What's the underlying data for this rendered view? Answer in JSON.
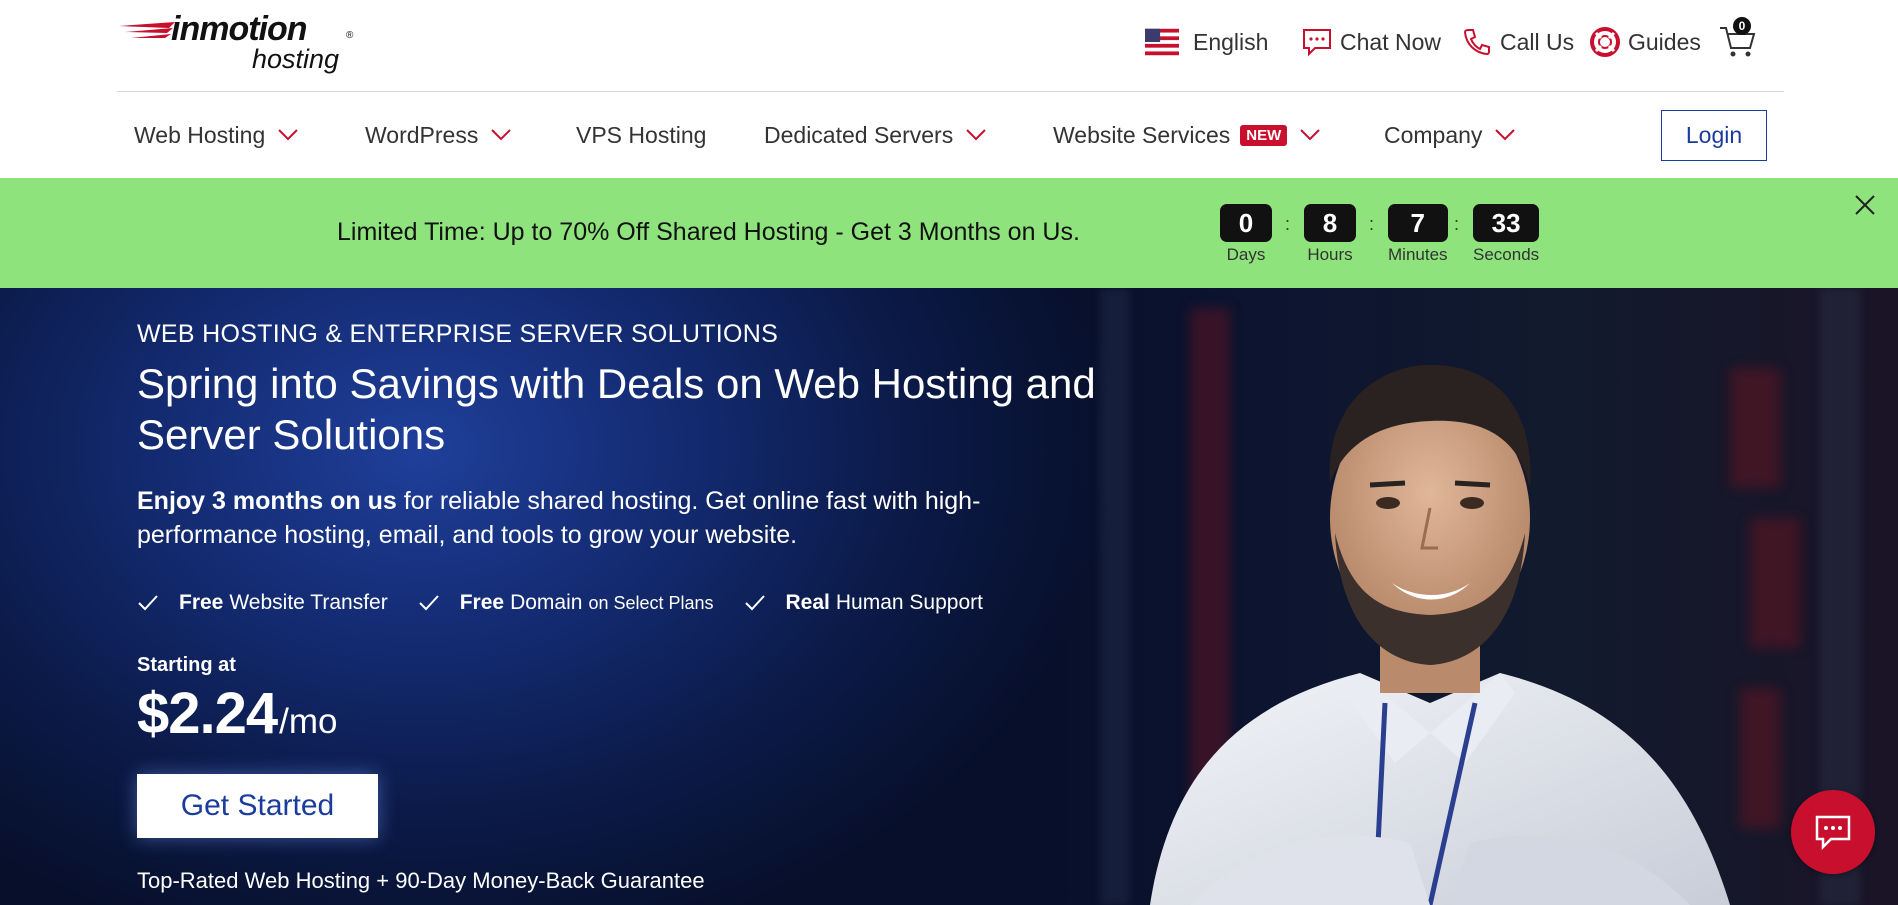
{
  "brand": {
    "name": "inmotion",
    "sub": "hosting",
    "reg": "®",
    "accent": "#c8102e"
  },
  "utility": {
    "language": "English",
    "chat": "Chat Now",
    "call": "Call Us",
    "guides": "Guides",
    "cart_count": "0"
  },
  "nav": {
    "items": [
      {
        "label": "Web Hosting"
      },
      {
        "label": "WordPress"
      },
      {
        "label": "VPS Hosting"
      },
      {
        "label": "Dedicated Servers"
      },
      {
        "label": "Website Services",
        "badge": "NEW"
      },
      {
        "label": "Company"
      }
    ],
    "login": "Login"
  },
  "promo": {
    "text": "Limited Time: Up to 70% Off Shared Hosting - Get 3 Months on Us.",
    "countdown": [
      {
        "value": "0",
        "label": "Days"
      },
      {
        "value": "8",
        "label": "Hours"
      },
      {
        "value": "7",
        "label": "Minutes"
      },
      {
        "value": "33",
        "label": "Seconds"
      }
    ],
    "separator": ":",
    "bg": "#8ee37c"
  },
  "hero": {
    "eyebrow": "WEB HOSTING & ENTERPRISE SERVER SOLUTIONS",
    "title": "Spring into Savings with Deals on Web Hosting and Server Solutions",
    "lead_bold": "Enjoy 3 months on us",
    "lead_rest": " for reliable shared hosting. Get online fast with high-performance hosting, email, and tools to grow your website.",
    "features": [
      {
        "bold": "Free",
        "text": "Website Transfer",
        "small": ""
      },
      {
        "bold": "Free",
        "text": "Domain",
        "small": "on Select Plans"
      },
      {
        "bold": "Real",
        "text": "Human Support",
        "small": ""
      }
    ],
    "starting_label": "Starting at",
    "price": "$2.24",
    "per": "/mo",
    "cta": "Get Started",
    "guarantee": "Top-Rated Web Hosting + 90-Day Money-Back Guarantee"
  }
}
